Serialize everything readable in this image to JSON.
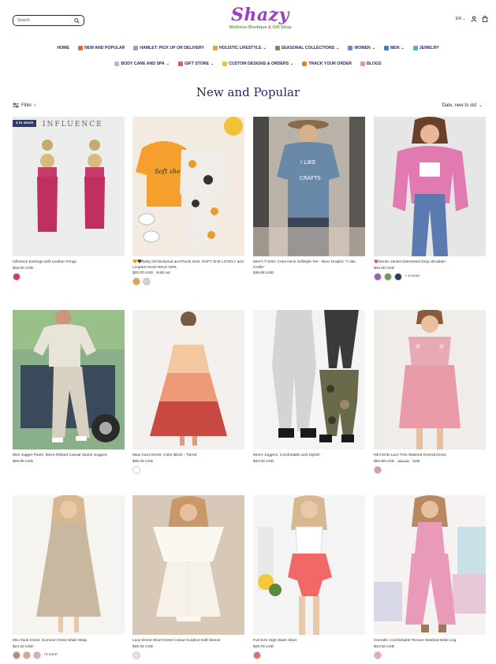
{
  "header": {
    "search_placeholder": "Search",
    "logo_name": "Shazy",
    "logo_tag_a": "Wellness Boutique",
    "logo_tag_amp": " & ",
    "logo_tag_b": "Gift Shop",
    "language": "EN"
  },
  "nav": {
    "row1": [
      {
        "label": "HOME",
        "icon": "",
        "chev": ""
      },
      {
        "label": "NEW AND POPULAR",
        "icon": "#e0683a",
        "chev": ""
      },
      {
        "label": "HAMLET: PICK UP OR DELIVERY",
        "icon": "#8ca0c8",
        "chev": ""
      },
      {
        "label": "HOLISTIC LIFESTYLE",
        "icon": "#e3a23a",
        "chev": "⌄"
      },
      {
        "label": "SEASONAL COLLECTIONS",
        "icon": "#9a7c62",
        "chev": "⌄"
      },
      {
        "label": "WOMEN",
        "icon": "#5a8fd6",
        "chev": "⌄"
      },
      {
        "label": "MEN",
        "icon": "#3a7fc6",
        "chev": "⌄"
      },
      {
        "label": "JEWELRY",
        "icon": "#4cb2d8",
        "chev": ""
      }
    ],
    "row2": [
      {
        "label": "BODY CARE AND SPA",
        "icon": "#b8b8c8",
        "chev": "⌄"
      },
      {
        "label": "GIFT STORE",
        "icon": "#e05a5a",
        "chev": "⌄"
      },
      {
        "label": "CUSTOM DESIGNS & ORDERS",
        "icon": "#e8c23a",
        "chev": "⌄"
      },
      {
        "label": "TRACK YOUR ORDER",
        "icon": "#d88a2a",
        "chev": ""
      },
      {
        "label": "BLOGS",
        "icon": "#d89ab8",
        "chev": ""
      }
    ]
  },
  "page_title": "New and Popular",
  "filter_label": "Filter",
  "sort_label": "Date, new to old",
  "products": [
    {
      "name": "Influence Earrings with Leather Fringe",
      "price": "$16.00 USD",
      "old": "",
      "extra": "",
      "badge": "1 in stock",
      "swatches": [
        "#c63a6e"
      ],
      "more": ""
    },
    {
      "name": "🧡🖤Baby Girl Bodysuit and Pants Sets: SOFT SHE LOVELY and Leopard Heart WILD GIRL",
      "price": "$20.00 USD",
      "old": "",
      "extra": "Sold out",
      "badge": "",
      "swatches": [
        "#e9a24a",
        "#d9cfc4"
      ],
      "more": ""
    },
    {
      "name": "Men's T-Shirt: Crew Neck Softstyle Tee - Beer Graphic \"I Like Crafts\"",
      "price": "$36.88 USD",
      "old": "",
      "extra": "",
      "badge": "",
      "swatches": [],
      "more": ""
    },
    {
      "name": "💗Denim Jacket Distressed Drop Shoulder",
      "price": "$44.00 USD",
      "old": "",
      "extra": "",
      "badge": "",
      "swatches": [
        "#9b5fb5",
        "#6a9a5a",
        "#2f3a66"
      ],
      "more": "+ 3 more"
    },
    {
      "name": "Men Jogger Pants: Micro-Ribbed Casual Sports Joggers",
      "price": "$28.99 USD",
      "old": "",
      "extra": "",
      "badge": "",
      "swatches": [],
      "more": ""
    },
    {
      "name": "Maxi Cami Dress: Color Block - Tiered",
      "price": "$36.34 USD",
      "old": "",
      "extra": "",
      "badge": "",
      "swatches": [
        "#ffffff"
      ],
      "more": ""
    },
    {
      "name": "Men's Joggers: Comfortable and Stylish",
      "price": "$34.00 USD",
      "old": "",
      "extra": "",
      "badge": "",
      "swatches": [],
      "more": ""
    },
    {
      "name": "HEYSON Lace Trim Washed Overall Dress",
      "price": "$53.99 USD",
      "old": "$65.99",
      "extra": "Sale",
      "badge": "",
      "swatches": [
        "#d89aa8"
      ],
      "more": ""
    },
    {
      "name": "Mini Tank Dress: Summer Dress-Wide Strap",
      "price": "$24.30 USD",
      "old": "",
      "extra": "",
      "badge": "",
      "swatches": [
        "#b89070",
        "#c8a8a0",
        "#e0a8b8"
      ],
      "more": "+3 more"
    },
    {
      "name": "Lace Dress Short Dress-Cutout Surplice-Half Sleeve",
      "price": "$36.34 USD",
      "old": "",
      "extra": "",
      "badge": "",
      "swatches": [
        "#e8e0d4"
      ],
      "more": ""
    },
    {
      "name": "Full Size High Waist Skort",
      "price": "$28.78 USD",
      "old": "",
      "extra": "",
      "badge": "",
      "swatches": [
        "#e86a6a"
      ],
      "more": ""
    },
    {
      "name": "Overalls: Comfortable-Texture Washed-Wide Leg",
      "price": "$43.92 USD",
      "old": "",
      "extra": "",
      "badge": "",
      "swatches": [
        "#e8a8c0"
      ],
      "more": ""
    }
  ],
  "colors": {
    "brand": "#9b3fc4",
    "nav_text": "#2f2560",
    "badge_bg": "#2f3a66"
  }
}
